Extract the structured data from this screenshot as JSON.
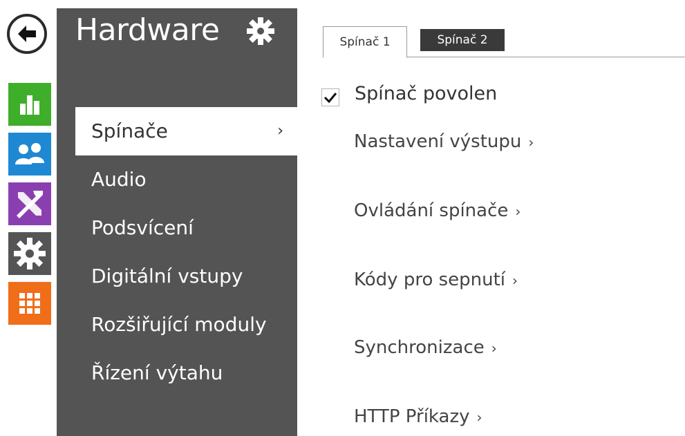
{
  "rail": {
    "items": [
      {
        "icon": "back-arrow-icon"
      },
      {
        "icon": "bar-chart-icon",
        "color": "#3fae2a"
      },
      {
        "icon": "users-icon",
        "color": "#1e88d2"
      },
      {
        "icon": "tools-icon",
        "color": "#8a3fb0"
      },
      {
        "icon": "gear-icon",
        "color": "#555555"
      },
      {
        "icon": "grid-icon",
        "color": "#f06d1a"
      }
    ]
  },
  "panel": {
    "title": "Hardware",
    "title_icon": "gear-icon",
    "menu": [
      {
        "label": "Spínače",
        "active": true,
        "chevron": "›"
      },
      {
        "label": "Audio"
      },
      {
        "label": "Podsvícení"
      },
      {
        "label": "Digitální vstupy"
      },
      {
        "label": "Rozšiřující moduly"
      },
      {
        "label": "Řízení výtahu"
      }
    ]
  },
  "tabs": [
    {
      "label": "Spínač 1",
      "active": true
    },
    {
      "label": "Spínač 2",
      "active": false
    }
  ],
  "content": {
    "enabled_checkbox": {
      "label": "Spínač povolen",
      "checked": true
    },
    "links": [
      {
        "label": "Nastavení výstupu",
        "arrow": "›"
      },
      {
        "label": "Ovládání spínače",
        "arrow": "›"
      },
      {
        "label": "Kódy pro sepnutí",
        "arrow": "›"
      },
      {
        "label": "Synchronizace",
        "arrow": "›"
      },
      {
        "label": "HTTP Příkazy",
        "arrow": "›"
      }
    ]
  },
  "colors": {
    "panel_bg": "#545454",
    "tab_inactive_bg": "#3a3a3a"
  }
}
